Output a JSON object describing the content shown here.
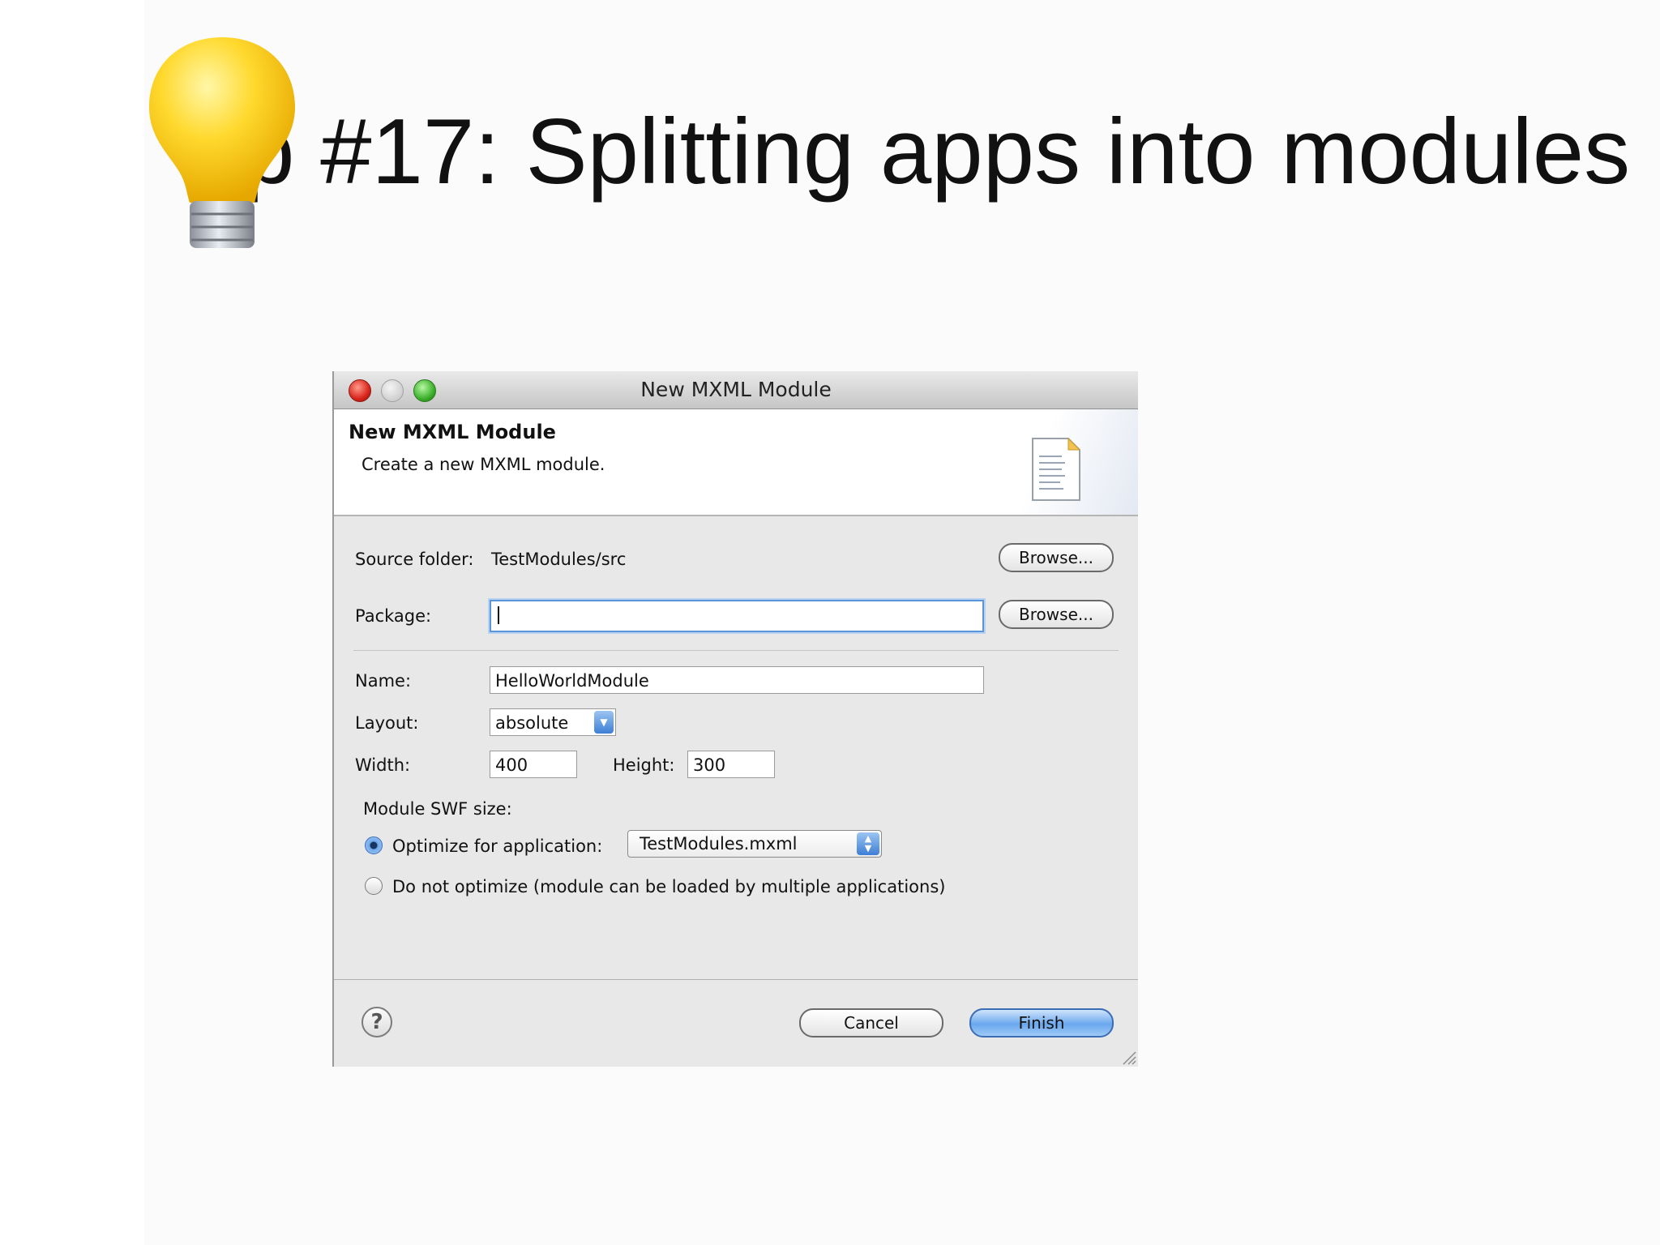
{
  "slide": {
    "title": "p #17: Splitting apps into modules",
    "icon": "lightbulb-icon"
  },
  "dialog": {
    "window_title": "New MXML Module",
    "header": {
      "title": "New MXML Module",
      "description": "Create a new MXML module.",
      "icon": "document-icon"
    },
    "source_folder": {
      "label": "Source folder:",
      "value": "TestModules/src",
      "browse_label": "Browse..."
    },
    "package": {
      "label": "Package:",
      "value": "",
      "browse_label": "Browse..."
    },
    "name": {
      "label": "Name:",
      "value": "HelloWorldModule"
    },
    "layout": {
      "label": "Layout:",
      "value": "absolute"
    },
    "width": {
      "label": "Width:",
      "value": "400"
    },
    "height": {
      "label": "Height:",
      "value": "300"
    },
    "module_swf": {
      "label": "Module SWF size:",
      "optimize_label": "Optimize for application:",
      "optimize_selected": true,
      "optimize_app": "TestModules.mxml",
      "no_optimize_label": "Do not optimize (module can be loaded by multiple applications)"
    },
    "buttons": {
      "cancel": "Cancel",
      "finish": "Finish",
      "help": "?"
    }
  },
  "colors": {
    "accent": "#6aa7ee",
    "close": "#d9251b",
    "maximize": "#3cb12c"
  }
}
